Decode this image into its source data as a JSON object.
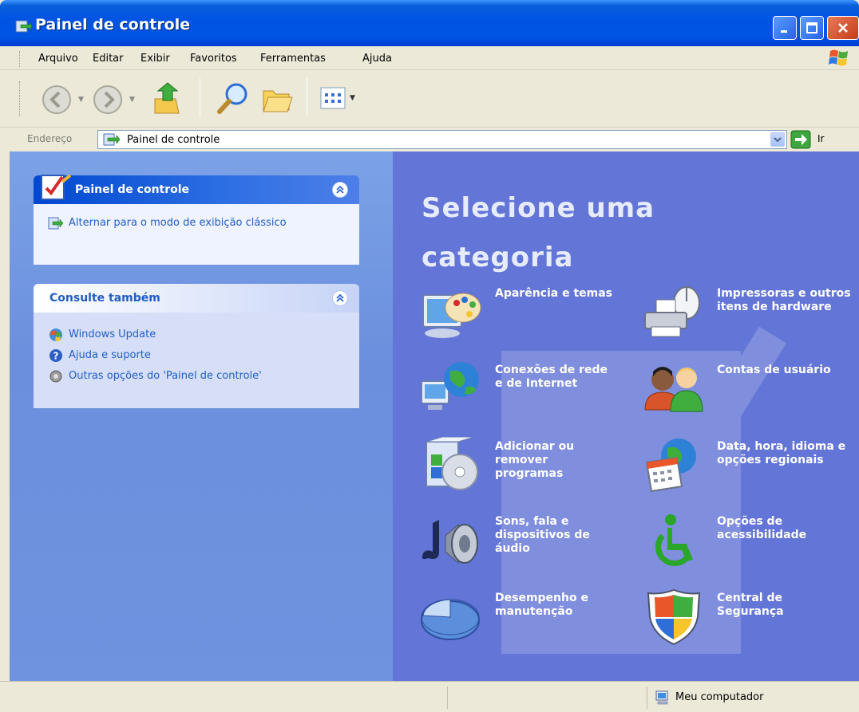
{
  "window": {
    "title": "Painel de controle",
    "accent": "#0054e3"
  },
  "menu": [
    "Arquivo",
    "Editar",
    "Exibir",
    "Favoritos",
    "Ferramentas",
    "Ajuda"
  ],
  "toolbar": {
    "icons": [
      "back-icon",
      "forward-icon",
      "up-folder-icon",
      "search-icon",
      "folders-icon",
      "views-icon"
    ]
  },
  "address": {
    "label": "Endereço",
    "value": "Painel de controle",
    "go_label": "Ir"
  },
  "left_pane": {
    "box1": {
      "title": "Painel de controle",
      "tasks": [
        {
          "label": "Alternar para o modo de exibição clássico",
          "icon": "switch-view-icon"
        }
      ]
    },
    "box2": {
      "title": "Consulte também",
      "tasks": [
        {
          "label": "Windows Update",
          "icon": "windows-update-icon"
        },
        {
          "label": "Ajuda e suporte",
          "icon": "help-icon"
        },
        {
          "label": "Outras opções do 'Painel de controle'",
          "icon": "gear-icon"
        }
      ]
    }
  },
  "main": {
    "heading": "Selecione uma categoria",
    "categories": [
      {
        "label": "Aparência e temas",
        "icon": "appearance-icon"
      },
      {
        "label": "Impressoras e outros itens de hardware",
        "icon": "printer-icon"
      },
      {
        "label": "Conexões de rede e de Internet",
        "icon": "network-icon"
      },
      {
        "label": "Contas de usuário",
        "icon": "user-accounts-icon"
      },
      {
        "label": "Adicionar ou remover programas",
        "icon": "add-remove-programs-icon"
      },
      {
        "label": "Data, hora, idioma e opções regionais",
        "icon": "date-time-icon"
      },
      {
        "label": "Sons, fala e dispositivos de áudio",
        "icon": "sound-icon"
      },
      {
        "label": "Opções de acessibilidade",
        "icon": "accessibility-icon"
      },
      {
        "label": "Desempenho e manutenção",
        "icon": "performance-icon"
      },
      {
        "label": "Central de Segurança",
        "icon": "security-shield-icon"
      }
    ]
  },
  "status": {
    "location": "Meu computador"
  }
}
